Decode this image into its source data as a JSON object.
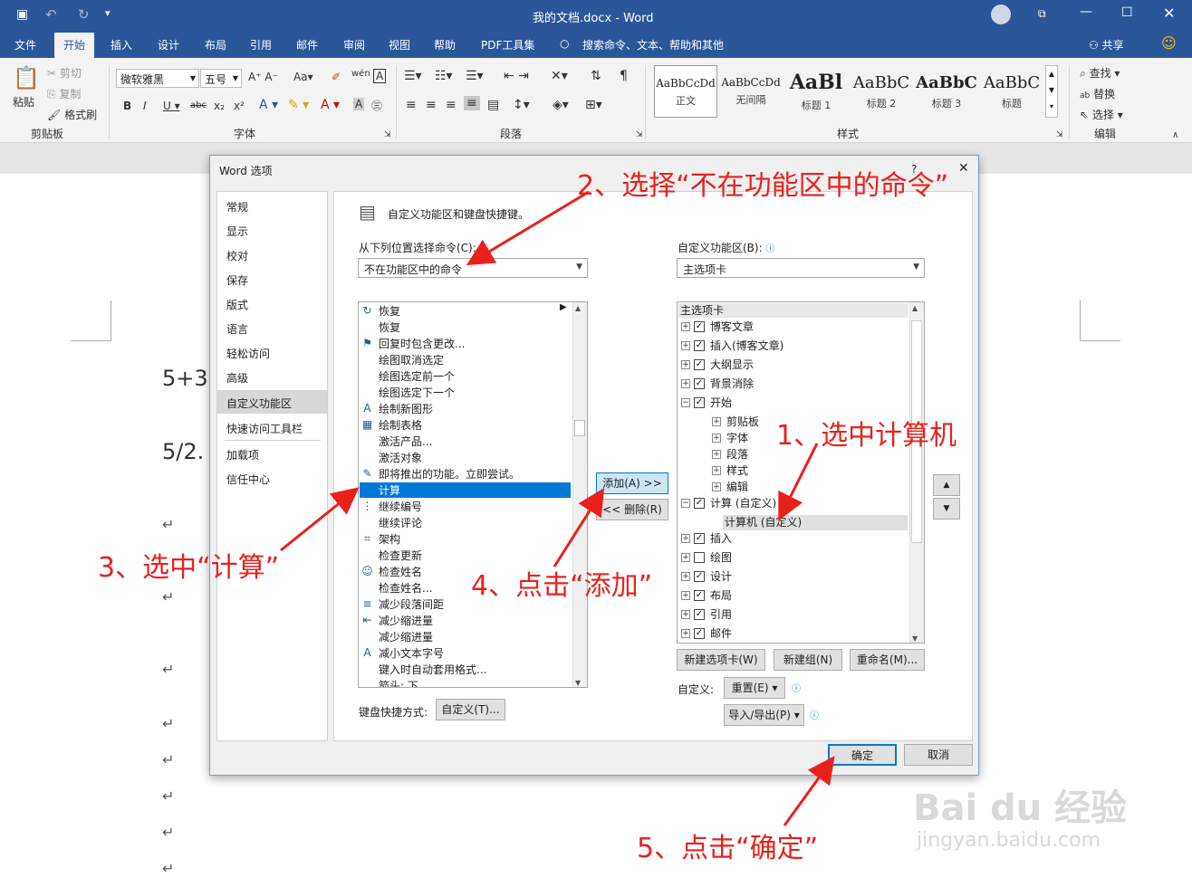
{
  "window": {
    "title": "我的文档.docx  -  Word"
  },
  "quick_access": {
    "save": "save-icon",
    "undo": "undo-icon",
    "redo": "redo-icon",
    "customize": "▾"
  },
  "ribbon_tabs": [
    "文件",
    "开始",
    "插入",
    "设计",
    "布局",
    "引用",
    "邮件",
    "审阅",
    "视图",
    "帮助",
    "PDF工具集"
  ],
  "active_tab": "开始",
  "search_hint": "搜索命令、文本、帮助和其他",
  "share_label": "共享",
  "clipboard": {
    "paste": "粘贴",
    "cut": "剪切",
    "copy": "复制",
    "format_painter": "格式刷",
    "group": "剪贴板"
  },
  "font": {
    "name": "微软雅黑",
    "size": "五号",
    "group": "字体"
  },
  "paragraph": {
    "group": "段落"
  },
  "styles": {
    "group": "样式",
    "items": [
      {
        "preview": "AaBbCcDd",
        "name": "正文"
      },
      {
        "preview": "AaBbCcDd",
        "name": "无间隔"
      },
      {
        "preview": "AaBl",
        "name": "标题 1"
      },
      {
        "preview": "AaBbC",
        "name": "标题 2"
      },
      {
        "preview": "AaBbC",
        "name": "标题 3"
      },
      {
        "preview": "AaBbC",
        "name": "标题"
      }
    ]
  },
  "editing": {
    "find": "查找",
    "replace": "替换",
    "select": "选择",
    "group": "编辑"
  },
  "document": {
    "line1": "5+3",
    "line2": "5/2."
  },
  "dialog": {
    "title": "Word 选项",
    "help": "?",
    "nav": [
      "常规",
      "显示",
      "校对",
      "保存",
      "版式",
      "语言",
      "轻松访问",
      "高级",
      "自定义功能区",
      "快速访问工具栏",
      "加载项",
      "信任中心"
    ],
    "nav_selected": "自定义功能区",
    "heading": "自定义功能区和键盘快捷键。",
    "choose_from_label": "从下列位置选择命令(C):",
    "choose_from_value": "不在功能区中的命令",
    "customize_label": "自定义功能区(B):",
    "customize_value": "主选项卡",
    "commands": [
      "恢复",
      "恢复",
      "回复时包含更改...",
      "绘图取消选定",
      "绘图选定前一个",
      "绘图选定下一个",
      "绘制新图形",
      "绘制表格",
      "激活产品...",
      "激活对象",
      "即将推出的功能。立即尝试。",
      "计算",
      "继续编号",
      "继续评论",
      "架构",
      "检查更新",
      "检查姓名",
      "检查姓名...",
      "减少段落间距",
      "减少缩进量",
      "减少缩进量",
      "减小文本字号",
      "键入时自动套用格式...",
      "箭头: 下"
    ],
    "selected_command": "计算",
    "add_button": "添加(A) >>",
    "remove_button": "<< 删除(R)",
    "tree_header": "主选项卡",
    "tree": [
      {
        "label": "博客文章",
        "checked": true,
        "level": 0,
        "sign": "+"
      },
      {
        "label": "插入(博客文章)",
        "checked": true,
        "level": 0,
        "sign": "+"
      },
      {
        "label": "大纲显示",
        "checked": true,
        "level": 0,
        "sign": "+"
      },
      {
        "label": "背景消除",
        "checked": true,
        "level": 0,
        "sign": "+"
      },
      {
        "label": "开始",
        "checked": true,
        "level": 0,
        "sign": "−"
      },
      {
        "label": "剪贴板",
        "checked": null,
        "level": 1,
        "sign": "+"
      },
      {
        "label": "字体",
        "checked": null,
        "level": 1,
        "sign": "+"
      },
      {
        "label": "段落",
        "checked": null,
        "level": 1,
        "sign": "+"
      },
      {
        "label": "样式",
        "checked": null,
        "level": 1,
        "sign": "+"
      },
      {
        "label": "编辑",
        "checked": null,
        "level": 1,
        "sign": "+"
      },
      {
        "label": "计算 (自定义)",
        "checked": true,
        "level": 0,
        "sign": "−"
      },
      {
        "label": "计算机 (自定义)",
        "checked": null,
        "level": 2,
        "sign": ""
      },
      {
        "label": "插入",
        "checked": true,
        "level": 0,
        "sign": "+"
      },
      {
        "label": "绘图",
        "checked": false,
        "level": 0,
        "sign": "+"
      },
      {
        "label": "设计",
        "checked": true,
        "level": 0,
        "sign": "+"
      },
      {
        "label": "布局",
        "checked": true,
        "level": 0,
        "sign": "+"
      },
      {
        "label": "引用",
        "checked": true,
        "level": 0,
        "sign": "+"
      },
      {
        "label": "邮件",
        "checked": true,
        "level": 0,
        "sign": "+"
      }
    ],
    "new_tab": "新建选项卡(W)",
    "new_group": "新建组(N)",
    "rename": "重命名(M)...",
    "customize_row_label": "自定义:",
    "reset": "重置(E) ▾",
    "import_export": "导入/导出(P) ▾",
    "keyboard_label": "键盘快捷方式:",
    "keyboard_button": "自定义(T)...",
    "ok": "确定",
    "cancel": "取消"
  },
  "annotations": {
    "a1": "1、选中计算机",
    "a2": "2、选择“不在功能区中的命令”",
    "a3": "3、选中“计算”",
    "a4": "4、点击“添加”",
    "a5": "5、点击“确定”"
  },
  "watermark": {
    "brand": "Bai du 经验",
    "url": "jingyan.baidu.com"
  },
  "colors": {
    "word_blue": "#2b579a",
    "selection": "#0078d7",
    "annotation_red": "#e8211d"
  }
}
